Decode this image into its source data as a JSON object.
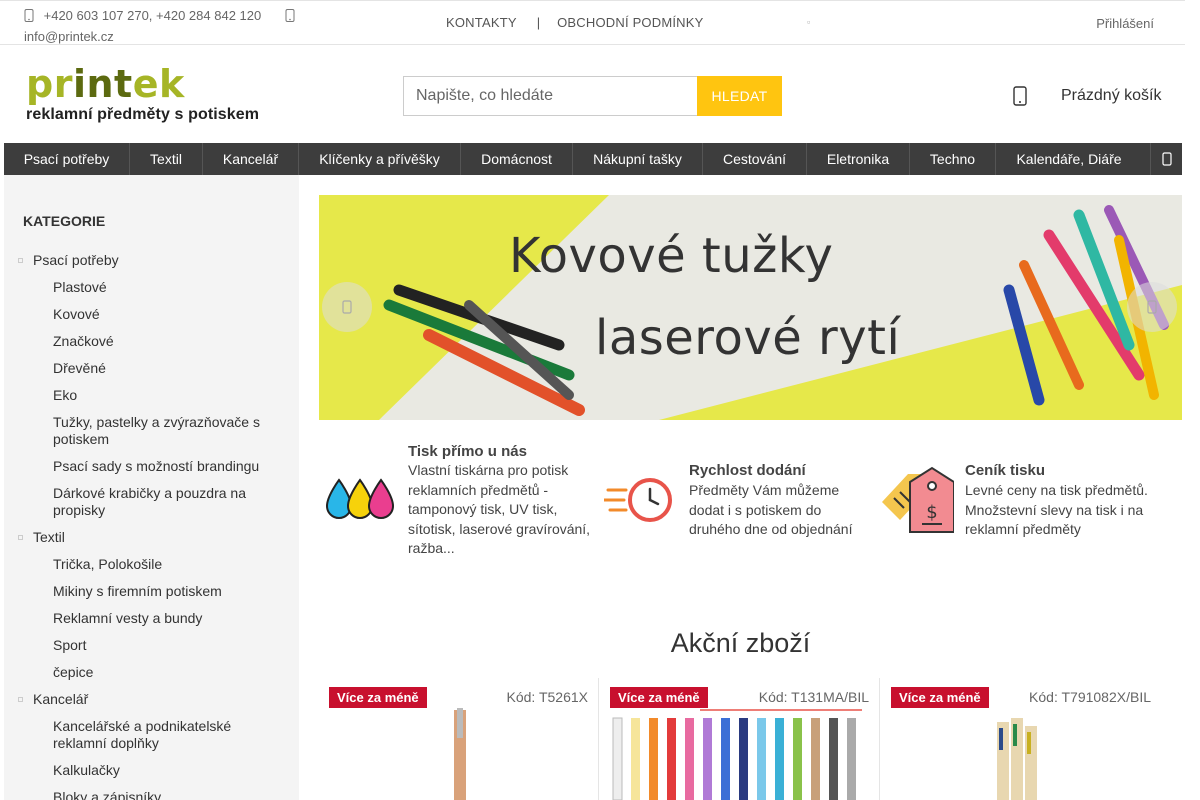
{
  "topbar": {
    "phones": "+420 603 107 270, +420 284 842 120",
    "email": "info@printek.cz",
    "links": [
      {
        "label": "KONTAKTY"
      },
      {
        "label": "OBCHODNÍ PODMÍNKY"
      }
    ],
    "separator": "|",
    "login": "Přihlášení"
  },
  "header": {
    "logo_word_light": "pr",
    "logo_word_dark": "int",
    "logo_word_end": "ek",
    "logo_tagline": "reklamní předměty s potiskem",
    "search_placeholder": "Napište, co hledáte",
    "search_button": "HLEDAT",
    "cart_label": "Prázdný košík"
  },
  "nav": [
    {
      "label": "Psací potřeby"
    },
    {
      "label": "Textil"
    },
    {
      "label": "Kancelář"
    },
    {
      "label": "Klíčenky a přívěšky"
    },
    {
      "label": "Domácnost"
    },
    {
      "label": "Nákupní tašky"
    },
    {
      "label": "Cestování"
    },
    {
      "label": "Eletronika"
    },
    {
      "label": "Techno"
    },
    {
      "label": "Kalendáře, Diáře"
    }
  ],
  "sidebar": {
    "title": "KATEGORIE",
    "items": [
      {
        "label": "Psací potřeby",
        "level": "top"
      },
      {
        "label": "Plastové",
        "level": "sub"
      },
      {
        "label": "Kovové",
        "level": "sub"
      },
      {
        "label": "Značkové",
        "level": "sub"
      },
      {
        "label": "Dřevěné",
        "level": "sub"
      },
      {
        "label": "Eko",
        "level": "sub"
      },
      {
        "label": "Tužky, pastelky a zvýrazňovače s potiskem",
        "level": "sub"
      },
      {
        "label": "Psací sady s možností brandingu",
        "level": "sub"
      },
      {
        "label": "Dárkové krabičky a pouzdra na propisky",
        "level": "sub"
      },
      {
        "label": "Textil",
        "level": "top"
      },
      {
        "label": "Trička, Polokošile",
        "level": "sub"
      },
      {
        "label": "Mikiny s firemním potiskem",
        "level": "sub"
      },
      {
        "label": "Reklamní vesty a bundy",
        "level": "sub"
      },
      {
        "label": "Sport",
        "level": "sub"
      },
      {
        "label": "čepice",
        "level": "sub"
      },
      {
        "label": "Kancelář",
        "level": "top"
      },
      {
        "label": "Kancelářské a podnikatelské reklamní doplňky",
        "level": "sub"
      },
      {
        "label": "Kalkulačky",
        "level": "sub"
      },
      {
        "label": "Bloky a zápisníky",
        "level": "sub"
      }
    ]
  },
  "banner": {
    "title": "Kovové tužky",
    "subtitle": "laserové rytí"
  },
  "features": [
    {
      "title": "Tisk přímo u nás",
      "text": "Vlastní tiskárna pro potisk reklamních předmětů - tamponový tisk, UV tisk, sítotisk, laserové gravírování, ražba...",
      "icon": "ink-drops-icon"
    },
    {
      "title": "Rychlost dodání",
      "text": "Předměty Vám můžeme dodat i s potiskem do druhého dne od objednání",
      "icon": "fast-clock-icon"
    },
    {
      "title": "Ceník tisku",
      "text": "Levné ceny na tisk předmětů. Množstevní slevy na tisk i na reklamní předměty",
      "icon": "price-tag-icon"
    }
  ],
  "offers": {
    "title": "Akční zboží",
    "products": [
      {
        "badge": "Více za méně",
        "code": "Kód: T5261X"
      },
      {
        "badge": "Více za méně",
        "code": "Kód: T131MA/BIL"
      },
      {
        "badge": "Více za méně",
        "code": "Kód: T791082X/BIL"
      }
    ]
  },
  "colors": {
    "accent_yellow": "#ffc510",
    "nav_bg": "#3d3d3d",
    "badge_red": "#c8102e",
    "logo_green": "#a6b526",
    "banner_yellow": "#e6e84a"
  }
}
